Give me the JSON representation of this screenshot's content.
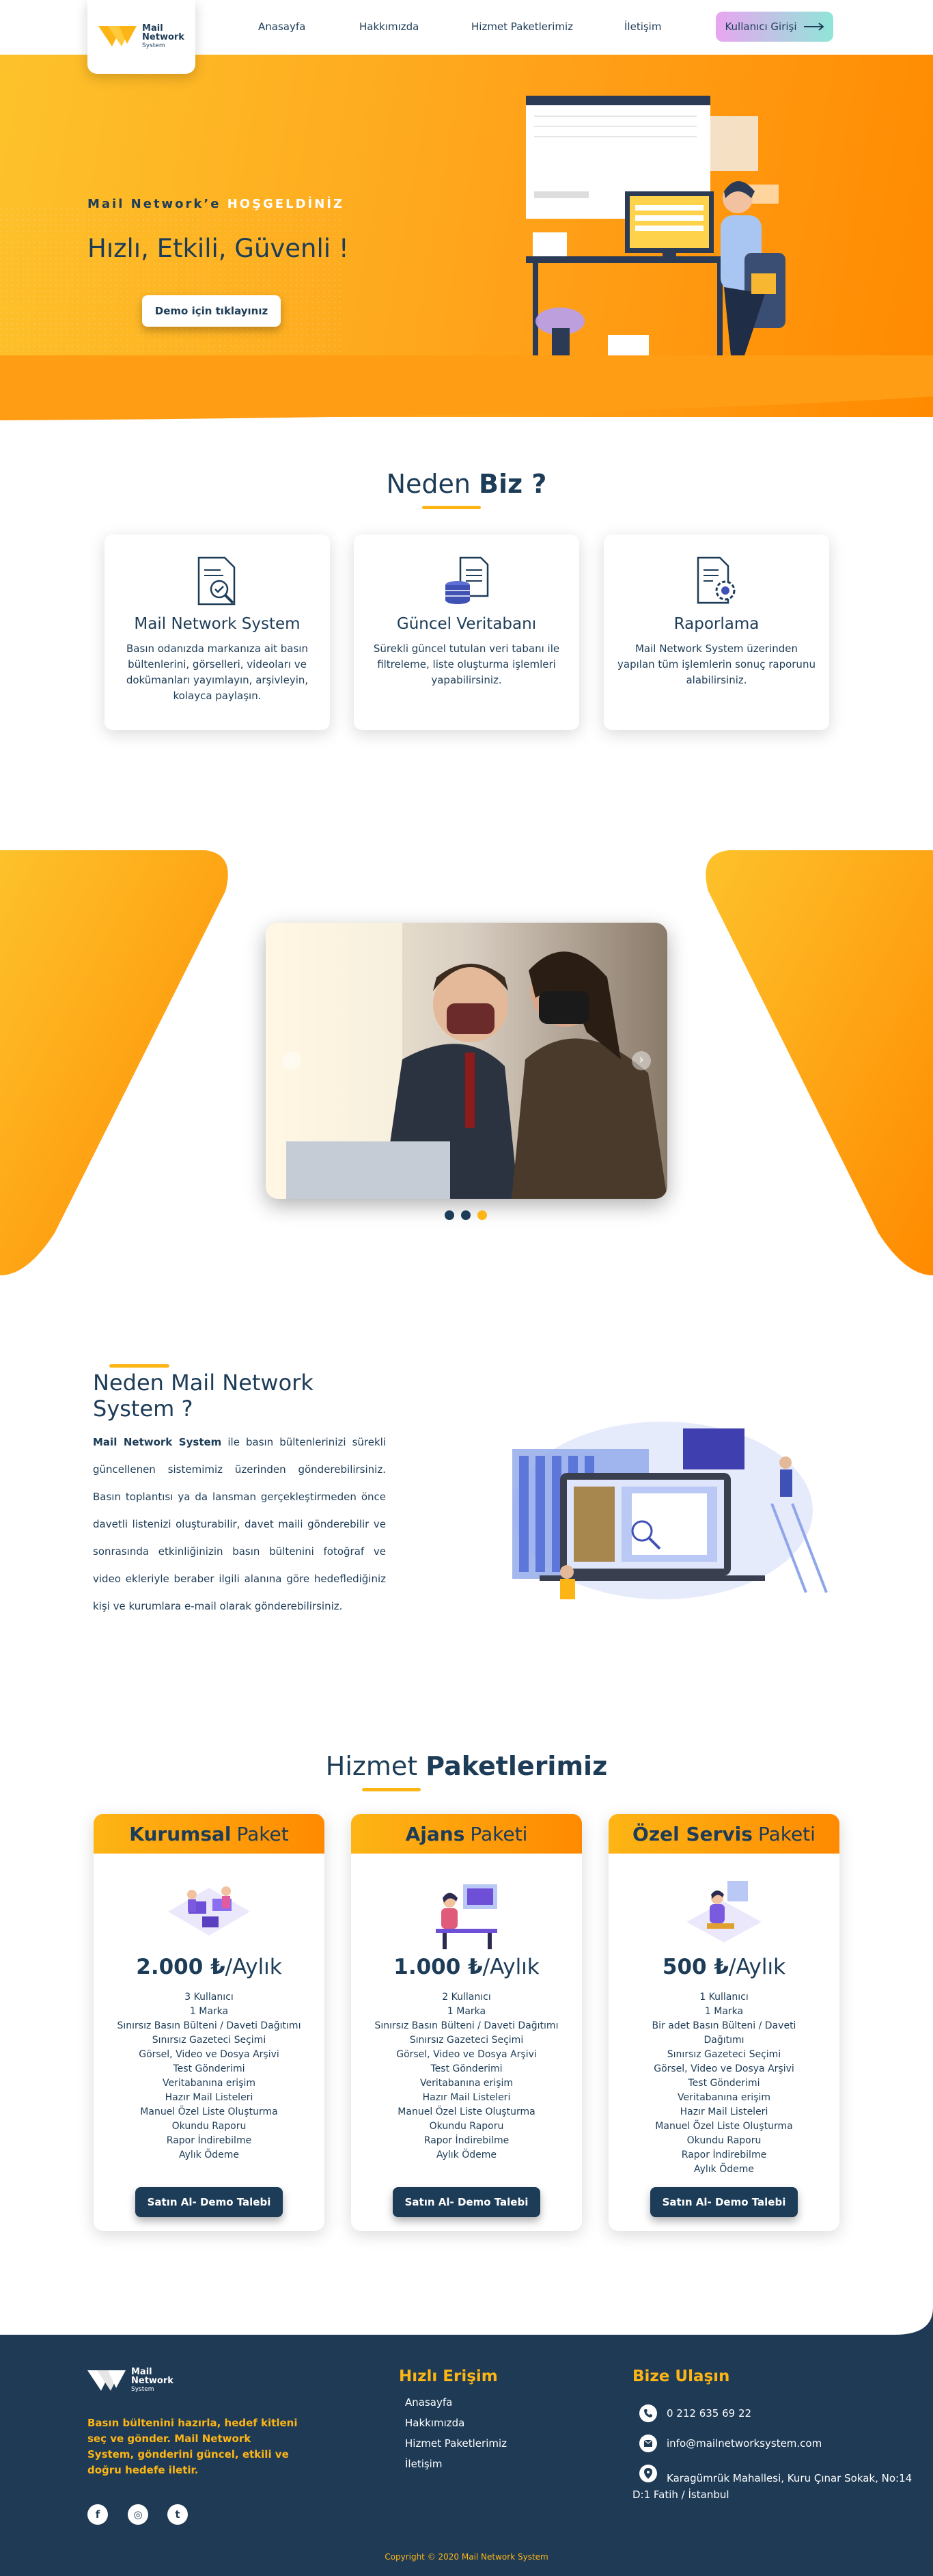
{
  "nav": {
    "logo": {
      "line1": "Mail",
      "line2": "Network",
      "line3": "System"
    },
    "links": [
      "Anasayfa",
      "Hakkımızda",
      "Hizmet Paketlerimiz",
      "İletişim"
    ],
    "login_label": "Kullanıcı Girişi"
  },
  "hero": {
    "welcome_prefix": "Mail Network’e ",
    "welcome_highlight": "HOŞGELDİNİZ",
    "title": "Hızlı, Etkili, Güvenli !",
    "demo_label": "Demo için tıklayınız"
  },
  "why_us": {
    "title_normal": "Neden ",
    "title_bold": "Biz ?",
    "cards": [
      {
        "icon": "document-check-icon",
        "title": "Mail Network System",
        "text": "Basın odanızda markanıza ait basın bültenlerini, görselleri, videoları ve dokümanları yayımlayın, arşivleyin, kolayca paylaşın."
      },
      {
        "icon": "database-document-icon",
        "title": "Güncel Veritabanı",
        "text": "Sürekli güncel tutulan veri tabanı ile filtreleme, liste oluşturma işlemleri yapabilirsiniz."
      },
      {
        "icon": "report-settings-icon",
        "title": "Raporlama",
        "text": "Mail Network System üzerinden yapılan tüm işlemlerin sonuç raporunu alabilirsiniz."
      }
    ]
  },
  "slider": {
    "active_index": 2,
    "slide_count": 3
  },
  "why_mail": {
    "title": "Neden Mail Network System ?",
    "text_bold": "Mail Network System",
    "text_rest": " ile basın bültenlerinizi sürekli güncellenen sistemimiz üzerinden gönderebilirsiniz. Basın toplantısı ya da lansman gerçekleştirmeden önce davetli listenizi oluşturabilir, davet maili gönderebilir ve sonrasında etkinliğinizin basın bültenini fotoğraf ve video ekleriyle beraber ilgili alanına göre hedeflediğiniz kişi ve kurumlara e-mail olarak gönderebilirsiniz."
  },
  "packages": {
    "title_normal": "Hizmet ",
    "title_bold": "Paketlerimiz",
    "items": [
      {
        "name_bold": "Kurumsal",
        "name_rest": "Paket",
        "price_bold": "2.000 ₺",
        "price_rest": "/Aylık",
        "features": [
          "3 Kullanıcı",
          "1 Marka",
          "Sınırsız Basın Bülteni / Daveti Dağıtımı",
          "Sınırsız Gazeteci Seçimi",
          "Görsel, Video ve Dosya Arşivi",
          "Test Gönderimi",
          "Veritabanına erişim",
          "Hazır Mail Listeleri",
          "Manuel Özel Liste Oluşturma",
          "Okundu Raporu",
          "Rapor İndirebilme",
          "Aylık Ödeme"
        ],
        "button": "Satın Al- Demo Talebi"
      },
      {
        "name_bold": "Ajans",
        "name_rest": "Paketi",
        "price_bold": "1.000 ₺",
        "price_rest": "/Aylık",
        "features": [
          "2 Kullanıcı",
          "1 Marka",
          "Sınırsız Basın Bülteni / Daveti Dağıtımı",
          "Sınırsız Gazeteci Seçimi",
          "Görsel, Video ve Dosya Arşivi",
          "Test Gönderimi",
          "Veritabanına erişim",
          "Hazır Mail Listeleri",
          "Manuel Özel Liste Oluşturma",
          "Okundu Raporu",
          "Rapor İndirebilme",
          "Aylık Ödeme"
        ],
        "button": "Satın Al- Demo Talebi"
      },
      {
        "name_bold": "Özel Servis",
        "name_rest": "Paketi",
        "price_bold": "500 ₺",
        "price_rest": "/Aylık",
        "features": [
          "1 Kullanıcı",
          "1 Marka",
          "Bir adet Basın Bülteni / Daveti Dağıtımı",
          "Sınırsız Gazeteci Seçimi",
          "Görsel, Video ve Dosya Arşivi",
          "Test Gönderimi",
          "Veritabanına erişim",
          "Hazır Mail Listeleri",
          "Manuel Özel Liste Oluşturma",
          "Okundu Raporu",
          "Rapor İndirebilme",
          "Aylık Ödeme"
        ],
        "button": "Satın Al- Demo Talebi"
      }
    ]
  },
  "footer": {
    "description": "Basın bültenini hazırla, hedef kitleni seç ve gönder. Mail Network System, gönderini güncel, etkili ve doğru hedefe iletir.",
    "quick_title": "Hızlı Erişim",
    "quick_links": [
      "Anasayfa",
      "Hakkımızda",
      "Hizmet Paketlerimiz",
      "İletişim"
    ],
    "contact_title": "Bize Ulaşın",
    "phone": "0 212 635 69 22",
    "email": "info@mailnetworksystem.com",
    "address": "Karagümrük Mahallesi, Kuru Çınar Sokak, No:14 D:1 Fatih / İstanbul",
    "copyright": "Copyright © 2020 Mail Network System"
  },
  "colors": {
    "brand_navy": "#1d3c57",
    "accent_yellow": "#fdb515",
    "accent_orange": "#ff8a00"
  }
}
